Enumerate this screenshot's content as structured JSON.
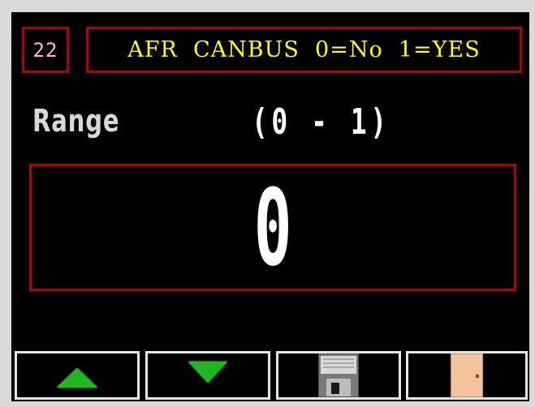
{
  "parameter": {
    "number": "22",
    "title": "AFR  CANBUS  0=No  1=YES"
  },
  "range": {
    "label": "Range",
    "value": "(0 - 1)"
  },
  "current_value": "0",
  "toolbar": {
    "buttons": [
      {
        "icon": "arrow-up-icon",
        "color": "#1fb81f"
      },
      {
        "icon": "arrow-down-icon",
        "color": "#1fb81f"
      },
      {
        "icon": "floppy-disk-icon",
        "color": "#808080"
      },
      {
        "icon": "door-icon",
        "color": "#f5c39b"
      }
    ]
  },
  "colors": {
    "background": "#000000",
    "frame": "#b30000",
    "title_text": "#ffff00",
    "number_text": "#ffb7c8",
    "value_text": "#ffffff"
  }
}
